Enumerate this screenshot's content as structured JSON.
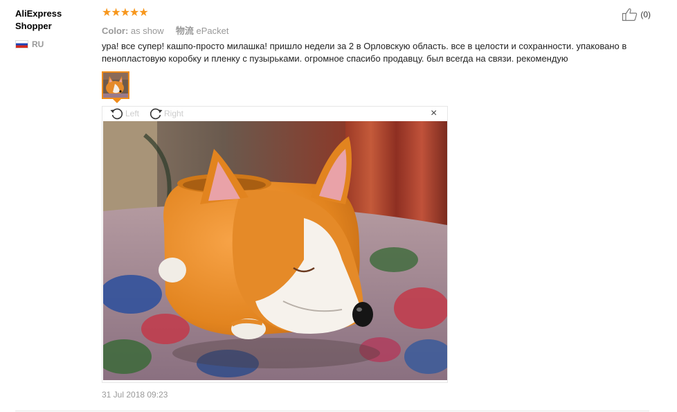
{
  "user": {
    "name": "AliExpress Shopper",
    "country": "RU"
  },
  "rating": {
    "stars": "★★★★★",
    "value": 5,
    "max": 5
  },
  "meta": {
    "color_label": "Color:",
    "color_value": "as show",
    "shipping_label": "物流",
    "shipping_value": "ePacket"
  },
  "helpful": {
    "count": "(0)"
  },
  "review": {
    "text": "ура! все супер! кашпо-просто милашка! пришло недели за 2 в Орловскую область. все в целости и сохранности. упаковано в пенопластовую коробку и пленку с пузырьками. огромное спасибо продавцу. был всегда на связи. рекомендую"
  },
  "viewer": {
    "rotate_left": "Left",
    "rotate_right": "Right",
    "close": "×"
  },
  "date": "31 Jul 2018 09:23",
  "colors": {
    "star": "#f7971d",
    "thumb_border": "#f08c1a"
  },
  "icons": [
    "flag-ru-icon",
    "thumbs-up-icon",
    "rotate-left-icon",
    "rotate-right-icon",
    "close-icon"
  ]
}
